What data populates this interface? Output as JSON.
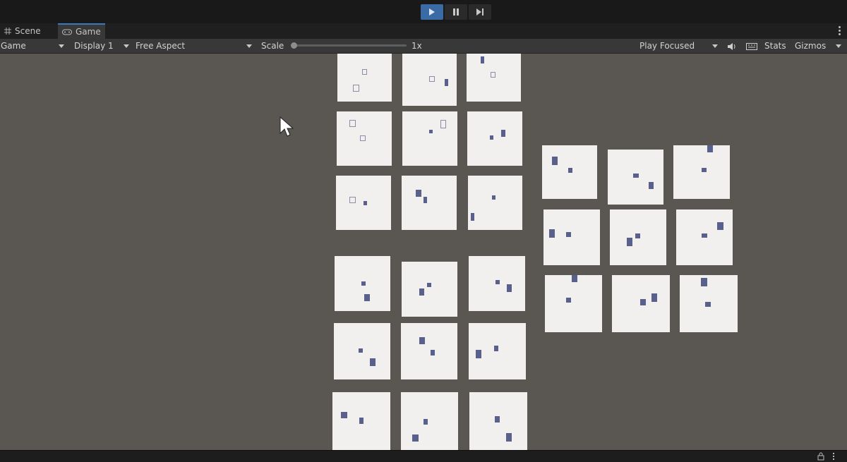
{
  "toolbar_top": {
    "play_icon": "play-icon",
    "pause_icon": "pause-icon",
    "step_icon": "step-icon"
  },
  "tabs": [
    {
      "label": "Scene",
      "icon": "grid-icon",
      "active": false
    },
    {
      "label": "Game",
      "icon": "gamepad-icon",
      "active": true
    }
  ],
  "game_toolbar": {
    "view_select": "Game",
    "display_select": "Display 1",
    "aspect_select": "Free Aspect",
    "scale_label": "Scale",
    "scale_value": "1x",
    "play_mode_select": "Play Focused",
    "audio_icon": "speaker-icon",
    "grid_icon": "keyboard-icon",
    "stats_label": "Stats",
    "gizmos_label": "Gizmos"
  },
  "colors": {
    "viewport_bg": "#5a5752",
    "panel_bg": "#f1f0ee",
    "glyph": "#59608c",
    "accent": "#3a79bb"
  }
}
